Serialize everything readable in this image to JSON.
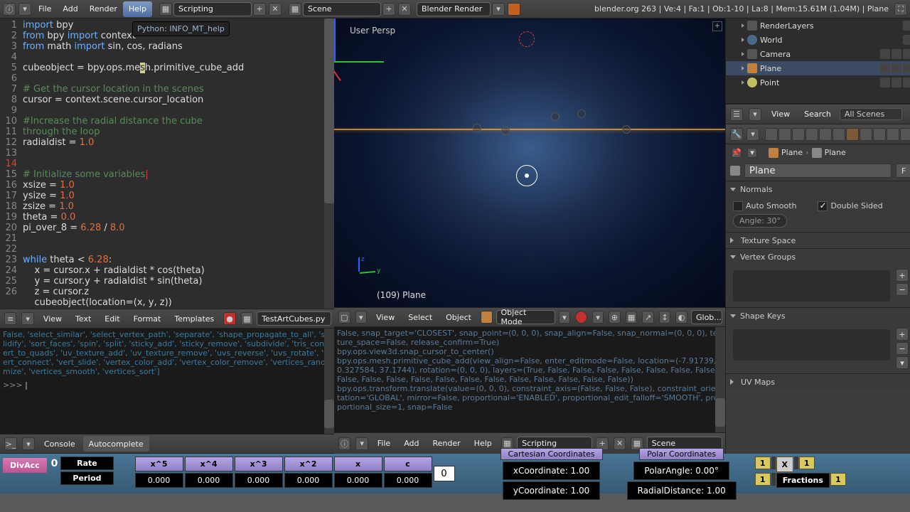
{
  "topbar": {
    "menu": [
      "File",
      "Add",
      "Render",
      "Help"
    ],
    "hover_index": 3,
    "layout": "Scripting",
    "scene": "Scene",
    "renderer": "Blender Render",
    "stats": "blender.org 263 | Ve:4 | Fa:1 | Ob:1-10 | La:8 | Mem:15.61M (1.04M) | Plane",
    "tooltip": "Python: INFO_MT_help"
  },
  "code": {
    "lines": [
      {
        "n": 1,
        "html": "<span class='kw'>import</span> bpy"
      },
      {
        "n": 2,
        "html": "<span class='kw'>from</span> bpy <span class='kw'>import</span> context"
      },
      {
        "n": 3,
        "html": "<span class='kw'>from</span> math <span class='kw'>import</span> sin, cos, radians"
      },
      {
        "n": 4,
        "html": ""
      },
      {
        "n": 5,
        "html": "cubeobject = bpy.ops.me<span style='background:#d0d090;color:#222;'>s</span>h.primitive_cube_add"
      },
      {
        "n": 6,
        "html": ""
      },
      {
        "n": 7,
        "html": "<span class='cmt'># Get the cursor location in the scenes</span>"
      },
      {
        "n": 8,
        "html": "cursor = context.scene.cursor_location"
      },
      {
        "n": 9,
        "html": ""
      },
      {
        "n": 10,
        "html": "<span class='cmt'>#Increase the radial distance the cube</span>"
      },
      {
        "n": "",
        "html": "<span class='cmt'>through the loop</span>"
      },
      {
        "n": 11,
        "html": "radialdist = <span class='num'>1.0</span>"
      },
      {
        "n": 12,
        "html": ""
      },
      {
        "n": 13,
        "html": ""
      },
      {
        "n": 14,
        "red": true,
        "html": "<span class='cmt'># Initialize some variables</span><span style='color:#e04040;'>|</span>"
      },
      {
        "n": 15,
        "html": "xsize = <span class='num'>1.0</span>"
      },
      {
        "n": 16,
        "html": "ysize = <span class='num'>1.0</span>"
      },
      {
        "n": 17,
        "html": "zsize = <span class='num'>1.0</span>"
      },
      {
        "n": 18,
        "html": "theta = <span class='num'>0.0</span>"
      },
      {
        "n": 19,
        "html": "pi_over_8 = <span class='num'>6.28</span> / <span class='num'>8.0</span>"
      },
      {
        "n": 20,
        "html": ""
      },
      {
        "n": 21,
        "html": ""
      },
      {
        "n": 22,
        "html": "<span class='kw'>while</span> theta &lt; <span class='num'>6.28</span>:"
      },
      {
        "n": 23,
        "html": "    x = cursor.x + radialdist * cos(theta)"
      },
      {
        "n": 24,
        "html": "    y = cursor.y + radialdist * sin(theta)"
      },
      {
        "n": 25,
        "html": "    z = cursor.z"
      },
      {
        "n": 26,
        "html": "    cubeobject(location=(x, y, z))"
      }
    ]
  },
  "text_header": {
    "menu": [
      "View",
      "Text",
      "Edit",
      "Format",
      "Templates"
    ],
    "file": "TestArtCubes.py"
  },
  "console": {
    "body": "False, 'select_similar', 'select_vertex_path', 'separate', 'shape_propagate_to_all', 'solidify', 'sort_faces', 'spin', 'split', 'sticky_add', 'sticky_remove', 'subdivide', 'tris_convert_to_quads', 'uv_texture_add', 'uv_texture_remove', 'uvs_reverse', 'uvs_rotate', 'vert_connect', 'vert_slide', 'vertex_color_add', 'vertex_color_remove', 'vertices_randomize', 'vertices_smooth', 'vertices_sort']",
    "prompt": ">>>"
  },
  "console_header": {
    "menu": [
      "Console",
      "Autocomplete"
    ]
  },
  "viewport": {
    "label": "User Persp",
    "obj": "(109) Plane"
  },
  "view_header": {
    "menu": [
      "View",
      "Select",
      "Object"
    ],
    "mode": "Object Mode",
    "orient": "Glob..."
  },
  "info": {
    "body": "False, snap_target='CLOSEST', snap_point=(0, 0, 0), snap_align=False, snap_normal=(0, 0, 0), texture_space=False, release_confirm=True)\nbpy.ops.view3d.snap_cursor_to_center()\nbpy.ops.mesh.primitive_cube_add(view_align=False, enter_editmode=False, location=(-7.91739, 0.327584, 37.1744), rotation=(0, 0, 0), layers=(True, False, False, False, False, False, False, False, False, False, False, False, False, False, False, False, False, False, False, False))\nbpy.ops.transform.translate(value=(0, 0, 0), constraint_axis=(False, False, False), constraint_orientation='GLOBAL', mirror=False, proportional='ENABLED', proportional_edit_falloff='SMOOTH', proportional_size=1, snap=False"
  },
  "bottom_bar": {
    "menu": [
      "File",
      "Add",
      "Render",
      "Help"
    ],
    "layout": "Scripting",
    "scene": "Scene"
  },
  "outliner": {
    "rows": [
      {
        "label": "RenderLayers",
        "icon": "cam",
        "indent": 1
      },
      {
        "label": "World",
        "icon": "world",
        "indent": 1
      },
      {
        "label": "Camera",
        "icon": "cam",
        "indent": 1,
        "vis": true
      },
      {
        "label": "Plane",
        "icon": "obj",
        "indent": 1,
        "sel": true,
        "vis": true
      },
      {
        "label": "Point",
        "icon": "light",
        "indent": 1,
        "vis": true
      }
    ]
  },
  "search_row": {
    "view": "View",
    "search": "Search",
    "scenes": "All Scenes"
  },
  "crumb": {
    "a": "Plane",
    "b": "Plane"
  },
  "name_field": {
    "value": "Plane",
    "f": "F"
  },
  "panels": {
    "normals": {
      "title": "Normals",
      "open": true,
      "auto": "Auto Smooth",
      "dbl": "Double Sided",
      "angle": "Angle: 30°"
    },
    "tex": {
      "title": "Texture Space"
    },
    "vg": {
      "title": "Vertex Groups",
      "open": true
    },
    "sk": {
      "title": "Shape Keys",
      "open": true
    },
    "uv": {
      "title": "UV Maps"
    }
  },
  "calc": {
    "divacc": "DivAcc",
    "divacc_val": "0",
    "rate": "Rate",
    "period": "Period",
    "poly_heads": [
      "x^5",
      "x^4",
      "x^3",
      "x^2",
      "x",
      "c"
    ],
    "poly_vals": [
      "0.000",
      "0.000",
      "0.000",
      "0.000",
      "0.000",
      "0.000"
    ],
    "zero": "0",
    "cart_title": "Cartesian Coordinates",
    "polar_title": "Polar Coordinates",
    "xc": "xCoordinate:  1.00",
    "yc": "yCoordinate:  1.00",
    "pa": "PolarAngle:  0.00°",
    "rd": "RadialDistance:  1.00",
    "frac": [
      "1",
      "1",
      "1",
      "1"
    ],
    "x": "X",
    "fractions": "Fractions"
  }
}
